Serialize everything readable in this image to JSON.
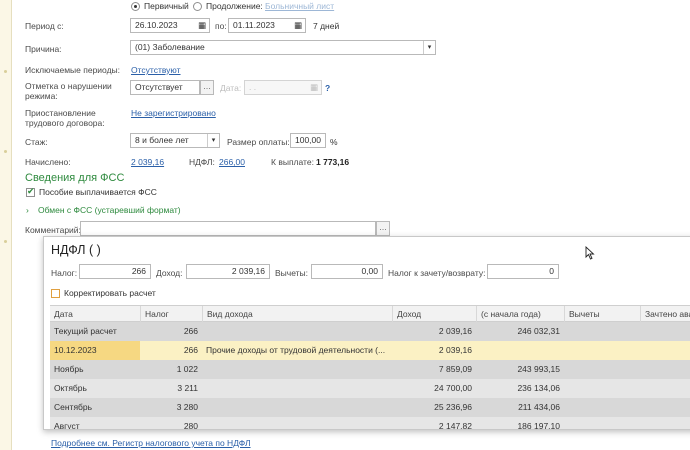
{
  "period": {
    "radio_primary": "Первичный",
    "radio_continuation": "Продолжение:",
    "continuation_link": "Больничный лист",
    "label_from": "Период с:",
    "date_from": "26.10.2023",
    "label_to": "по:",
    "date_to": "01.11.2023",
    "days": "7 дней"
  },
  "reason": {
    "label": "Причина:",
    "value": "(01) Заболевание"
  },
  "excluded": {
    "label": "Исключаемые периоды:",
    "value": "Отсутствуют"
  },
  "violation": {
    "label_line1": "Отметка о нарушении",
    "label_line2": "режима:",
    "value": "Отсутствует",
    "date_label": "Дата:",
    "date_placeholder": " .  .",
    "help": "?"
  },
  "suspension": {
    "label_line1": "Приостановление",
    "label_line2": "трудового договора:",
    "value": "Не зарегистрировано"
  },
  "experience": {
    "label": "Стаж:",
    "value": "8 и более лет",
    "pay_label": "Размер оплаты:",
    "pay_value": "100,00",
    "pay_unit": "%"
  },
  "accrued": {
    "label": "Начислено:",
    "value": "2 039,16",
    "ndfl_label": "НДФЛ:",
    "ndfl_value": "266,00",
    "payout_label": "К выплате:",
    "payout_value": "1 773,16"
  },
  "fss": {
    "section_title": "Сведения для ФСС",
    "benefit_checkbox": "Пособие выплачивается ФСС",
    "exchange_link": "Обмен с ФСС (устаревший формат)"
  },
  "comment": {
    "label": "Комментарий:",
    "value": ""
  },
  "popup": {
    "title": "НДФЛ (                          )",
    "tax_label": "Налог:",
    "tax_value": "266",
    "income_label": "Доход:",
    "income_value": "2 039,16",
    "deductions_label": "Вычеты:",
    "deductions_value": "0,00",
    "offset_label": "Налог к зачету/возврату:",
    "offset_value": "0",
    "correct_checkbox": "Корректировать расчет",
    "columns": [
      "Дата",
      "Налог",
      "Вид дохода",
      "Доход",
      "(с начала года)",
      "Вычеты",
      "Зачтено ава"
    ],
    "rows": [
      [
        "Текущий расчет",
        "266",
        "",
        "2 039,16",
        "246 032,31",
        "",
        ""
      ],
      [
        "10.12.2023",
        "266",
        "Прочие доходы от трудовой деятельности (...",
        "2 039,16",
        "",
        "",
        ""
      ],
      [
        "Ноябрь",
        "1 022",
        "",
        "7 859,09",
        "243 993,15",
        "",
        ""
      ],
      [
        "Октябрь",
        "3 211",
        "",
        "24 700,00",
        "236 134,06",
        "",
        ""
      ],
      [
        "Сентябрь",
        "3 280",
        "",
        "25 236,96",
        "211 434,06",
        "",
        ""
      ],
      [
        "Август",
        "280",
        "",
        "2 147,82",
        "186 197,10",
        "",
        ""
      ]
    ],
    "footer_link": "Подробнее см. Регистр налогового учета по НДФЛ"
  },
  "icons": {
    "calendar": "calendar-icon",
    "dropdown": "chevron-down-icon",
    "ellipsis": "ellipsis-button",
    "cursor": "mouse-cursor-icon"
  }
}
